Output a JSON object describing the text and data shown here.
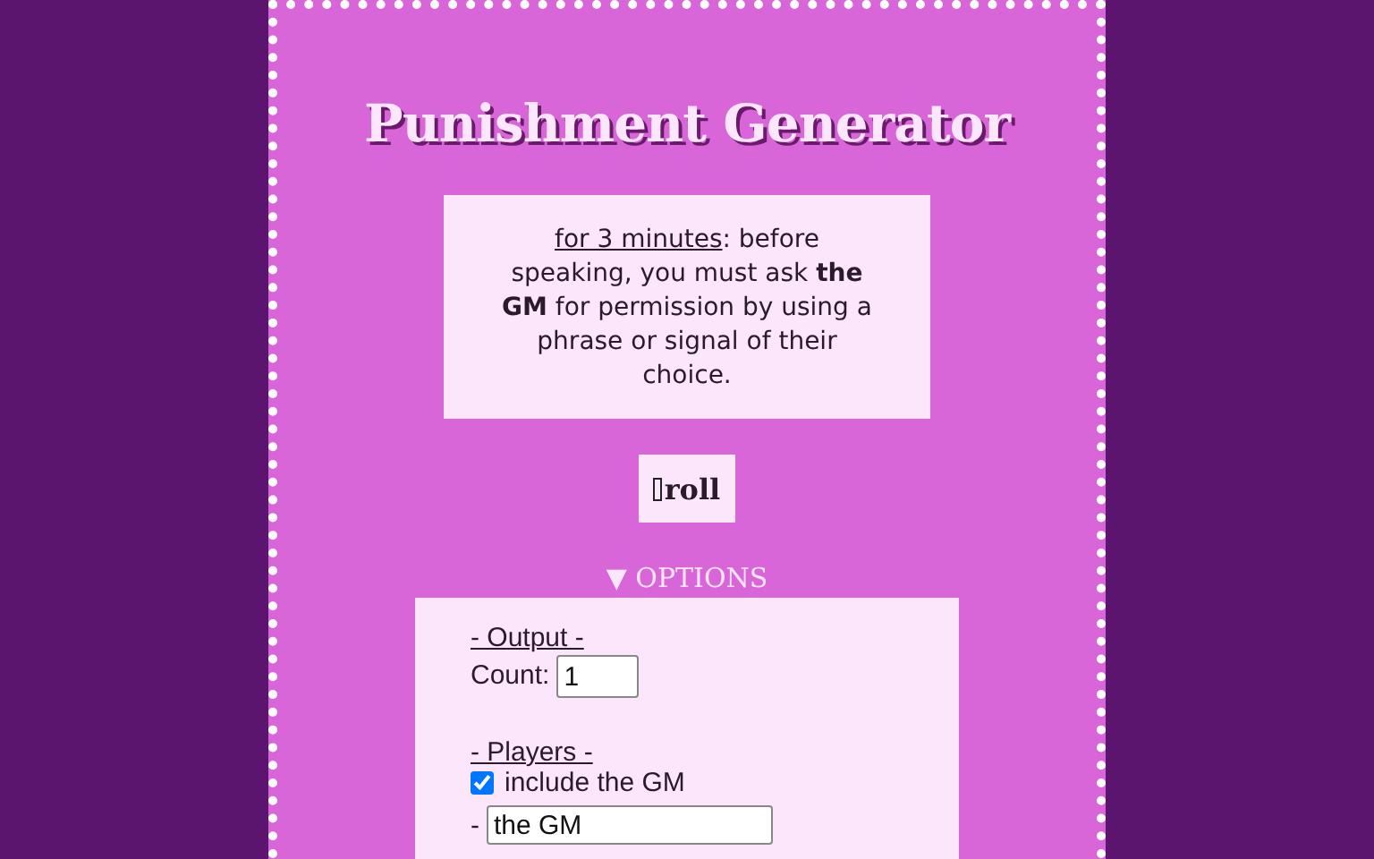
{
  "title": "Punishment Generator",
  "result": {
    "duration": "for 3 minutes",
    "text": ": before speaking, you must ask **the GM** for permission by using a phrase or signal of their choice."
  },
  "roll_button": {
    "label": "roll"
  },
  "options": {
    "marker": "▼",
    "label": "OPTIONS",
    "expanded": true,
    "sections": [
      {
        "heading": "- Output -",
        "fields": [
          {
            "kind": "number",
            "label": "Count:",
            "value": "1"
          }
        ]
      },
      {
        "heading": "- Players -",
        "fields": [
          {
            "kind": "checkbox",
            "label": "include the GM",
            "checked": true
          },
          {
            "kind": "text",
            "prefix": "-",
            "value": "the GM"
          }
        ]
      }
    ]
  }
}
